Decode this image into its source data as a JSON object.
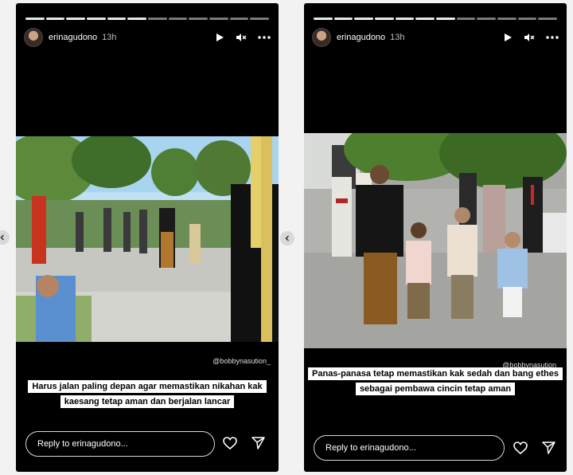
{
  "stories": [
    {
      "username": "erinagudono",
      "time": "13h",
      "credit": "@bobbynasution_",
      "caption": "Harus jalan paling depan agar memastikan nikahan kak kaesang tetap aman dan berjalan lancar",
      "reply_placeholder": "Reply to erinagudono..."
    },
    {
      "username": "erinagudono",
      "time": "13h",
      "credit": "@bobbynasution_",
      "caption": "Panas-panasa tetap memastikan kak sedah dan bang ethes sebagai pembawa cincin tetap aman",
      "reply_placeholder": "Reply to erinagudono..."
    }
  ],
  "icons": {
    "header": [
      "play-icon",
      "mute-icon",
      "more-icon"
    ],
    "footer": [
      "heart-icon",
      "send-icon"
    ],
    "nav": "chevron-left-icon"
  }
}
